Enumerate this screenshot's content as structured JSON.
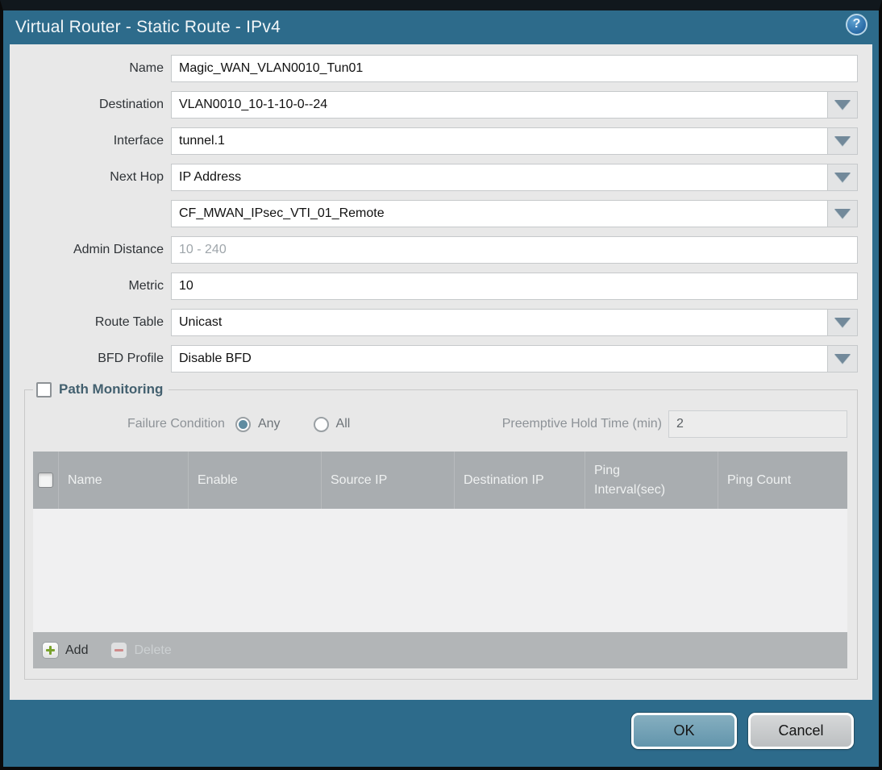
{
  "window": {
    "title": "Virtual Router - Static Route - IPv4"
  },
  "form": {
    "name": {
      "label": "Name",
      "value": "Magic_WAN_VLAN0010_Tun01"
    },
    "destination": {
      "label": "Destination",
      "value": "VLAN0010_10-1-10-0--24"
    },
    "interface": {
      "label": "Interface",
      "value": "tunnel.1"
    },
    "next_hop": {
      "label": "Next Hop",
      "value": "IP Address"
    },
    "next_hop_address": {
      "label": "",
      "value": "CF_MWAN_IPsec_VTI_01_Remote"
    },
    "admin_distance": {
      "label": "Admin Distance",
      "value": "",
      "placeholder": "10 - 240"
    },
    "metric": {
      "label": "Metric",
      "value": "10"
    },
    "route_table": {
      "label": "Route Table",
      "value": "Unicast"
    },
    "bfd_profile": {
      "label": "BFD Profile",
      "value": "Disable BFD"
    }
  },
  "path_monitoring": {
    "title": "Path Monitoring",
    "enabled": false,
    "failure_condition": {
      "label": "Failure Condition",
      "options": [
        "Any",
        "All"
      ],
      "selected": "Any"
    },
    "preemptive_hold_time": {
      "label": "Preemptive Hold Time (min)",
      "value": "2"
    },
    "table": {
      "columns": [
        "Name",
        "Enable",
        "Source IP",
        "Destination IP",
        "Ping Interval(sec)",
        "Ping Count"
      ],
      "rows": [],
      "actions": {
        "add": "Add",
        "delete": "Delete"
      }
    }
  },
  "footer": {
    "ok": "OK",
    "cancel": "Cancel"
  },
  "colors": {
    "chrome_teal": "#2d6b8b",
    "body_gray": "#e8e8e8",
    "table_header_gray": "#a9adb0",
    "ok_button_blue": "#6295ac",
    "add_icon_green": "#7aa22d"
  }
}
